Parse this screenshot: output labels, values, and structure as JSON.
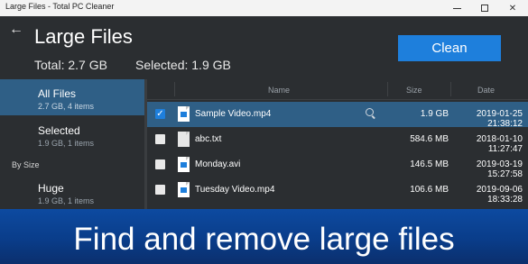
{
  "window": {
    "title": "Large Files - Total PC Cleaner"
  },
  "header": {
    "title": "Large Files",
    "total": "Total: 2.7 GB",
    "selected": "Selected: 1.9 GB",
    "clean_label": "Clean"
  },
  "sidebar": {
    "items": [
      {
        "label": "All Files",
        "sub": "2.7 GB, 4 items"
      },
      {
        "label": "Selected",
        "sub": "1.9 GB, 1 items"
      }
    ],
    "section_label": "By Size",
    "size_items": [
      {
        "label": "Huge",
        "sub": "1.9 GB, 1 items"
      }
    ]
  },
  "table": {
    "columns": [
      "Name",
      "Size",
      "Date"
    ],
    "rows": [
      {
        "name": "Sample Video.mp4",
        "size": "1.9 GB",
        "date": "2019-01-25 21:38:12",
        "checked": true
      },
      {
        "name": "abc.txt",
        "size": "584.6 MB",
        "date": "2018-01-10 11:27:47",
        "checked": false
      },
      {
        "name": "Monday.avi",
        "size": "146.5 MB",
        "date": "2019-03-19 15:27:58",
        "checked": false
      },
      {
        "name": "Tuesday Video.mp4",
        "size": "106.6 MB",
        "date": "2019-09-06 18:33:28",
        "checked": false
      }
    ]
  },
  "banner": {
    "text": "Find and remove large files"
  },
  "colors": {
    "accent": "#1e7fdc",
    "selection": "#2f5f86",
    "panel": "#2b2e31"
  }
}
